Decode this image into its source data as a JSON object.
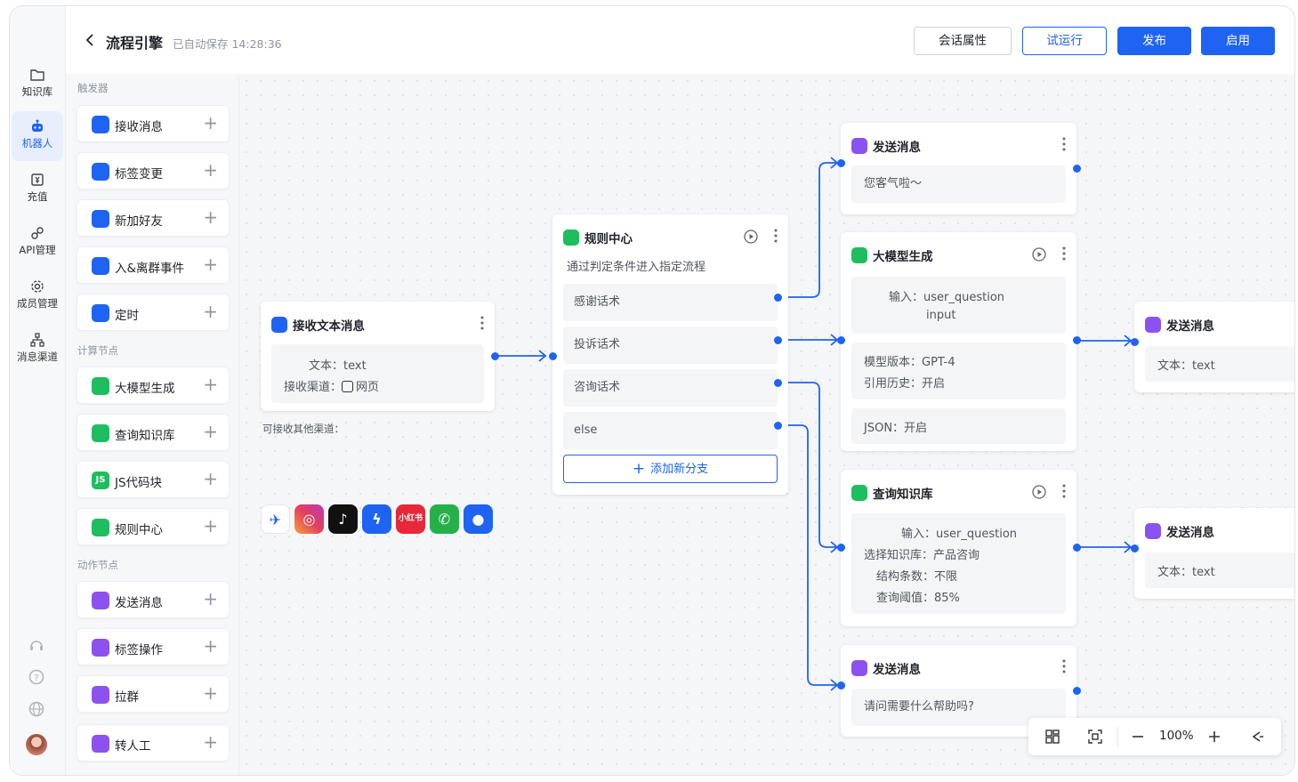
{
  "header": {
    "title": "流程引擎",
    "autosave": "已自动保存 14:28:36",
    "buttons": {
      "session_props": "会话属性",
      "test_run": "试运行",
      "publish": "发布",
      "enable": "启用"
    }
  },
  "rail": {
    "items": [
      {
        "label": "知识库",
        "icon": "folder-icon"
      },
      {
        "label": "机器人",
        "icon": "robot-icon"
      },
      {
        "label": "充值",
        "icon": "recharge-icon"
      },
      {
        "label": "API管理",
        "icon": "link-icon"
      },
      {
        "label": "成员管理",
        "icon": "gear-icon"
      },
      {
        "label": "消息渠道",
        "icon": "hierarchy-icon"
      }
    ]
  },
  "palette": {
    "sections": {
      "trigger": "触发器",
      "compute": "计算节点",
      "action": "动作节点"
    },
    "triggers": [
      {
        "label": "接收消息"
      },
      {
        "label": "标签变更"
      },
      {
        "label": "新加好友"
      },
      {
        "label": "入&离群事件"
      },
      {
        "label": "定时"
      }
    ],
    "compute": [
      {
        "label": "大模型生成"
      },
      {
        "label": "查询知识库"
      },
      {
        "label": "JS代码块"
      },
      {
        "label": "规则中心"
      }
    ],
    "actions": [
      {
        "label": "发送消息"
      },
      {
        "label": "标签操作"
      },
      {
        "label": "拉群"
      },
      {
        "label": "转人工"
      }
    ]
  },
  "nodes": {
    "receive": {
      "title": "接收文本消息",
      "text_label": "文本：",
      "text_value": "text",
      "channel_label": "接收渠道：",
      "channel_value": "网页"
    },
    "channels_label": "可接收其他渠道：",
    "channels": [
      {
        "name": "飞书",
        "color": "#1e63f2"
      },
      {
        "name": "Instagram",
        "color": "#e4405f"
      },
      {
        "name": "TikTok",
        "color": "#111111"
      },
      {
        "name": "Messenger",
        "color": "#1e63f2"
      },
      {
        "name": "小红书",
        "color": "#e8283a"
      },
      {
        "name": "WhatsApp",
        "color": "#25b04a"
      },
      {
        "name": "消息",
        "color": "#1e63f2"
      }
    ],
    "rule": {
      "title": "规则中心",
      "desc": "通过判定条件进入指定流程",
      "branches": [
        "感谢话术",
        "投诉话术",
        "咨询话术",
        "else"
      ],
      "add_branch": "添加新分支"
    },
    "send1": {
      "title": "发送消息",
      "body": "您客气啦～"
    },
    "llm": {
      "title": "大模型生成",
      "input_label": "输入：",
      "input_value": "user_question",
      "input_value2": "input",
      "model_label": "模型版本：",
      "model_value": "GPT-4",
      "history_label": "引用历史：",
      "history_value": "开启",
      "json_label": "JSON：",
      "json_value": "开启"
    },
    "send2": {
      "title": "发送消息",
      "text_label": "文本：",
      "text_value": "text"
    },
    "kb": {
      "title": "查询知识库",
      "input_label": "输入：",
      "input_value": "user_question",
      "kb_label": "选择知识库：",
      "kb_value": "产品咨询",
      "count_label": "结构条数：",
      "count_value": "不限",
      "threshold_label": "查询阈值：",
      "threshold_value": "85%"
    },
    "send3": {
      "title": "发送消息",
      "text_label": "文本：",
      "text_value": "text"
    },
    "send4": {
      "title": "发送消息",
      "body": "请问需要什么帮助吗?"
    }
  },
  "zoom": {
    "level": "100%"
  },
  "colors": {
    "accent": "#1e63f2",
    "purple": "#8c52f0",
    "green": "#1ebd5e"
  }
}
